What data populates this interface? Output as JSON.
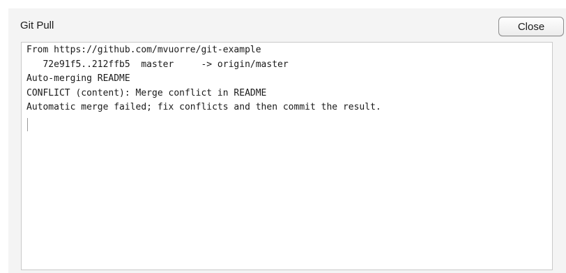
{
  "dialog": {
    "title": "Git Pull",
    "close_label": "Close"
  },
  "output": {
    "lines": [
      "From https://github.com/mvuorre/git-example",
      "   72e91f5..212ffb5  master     -> origin/master",
      "Auto-merging README",
      "CONFLICT (content): Merge conflict in README",
      "Automatic merge failed; fix conflicts and then commit the result."
    ]
  }
}
